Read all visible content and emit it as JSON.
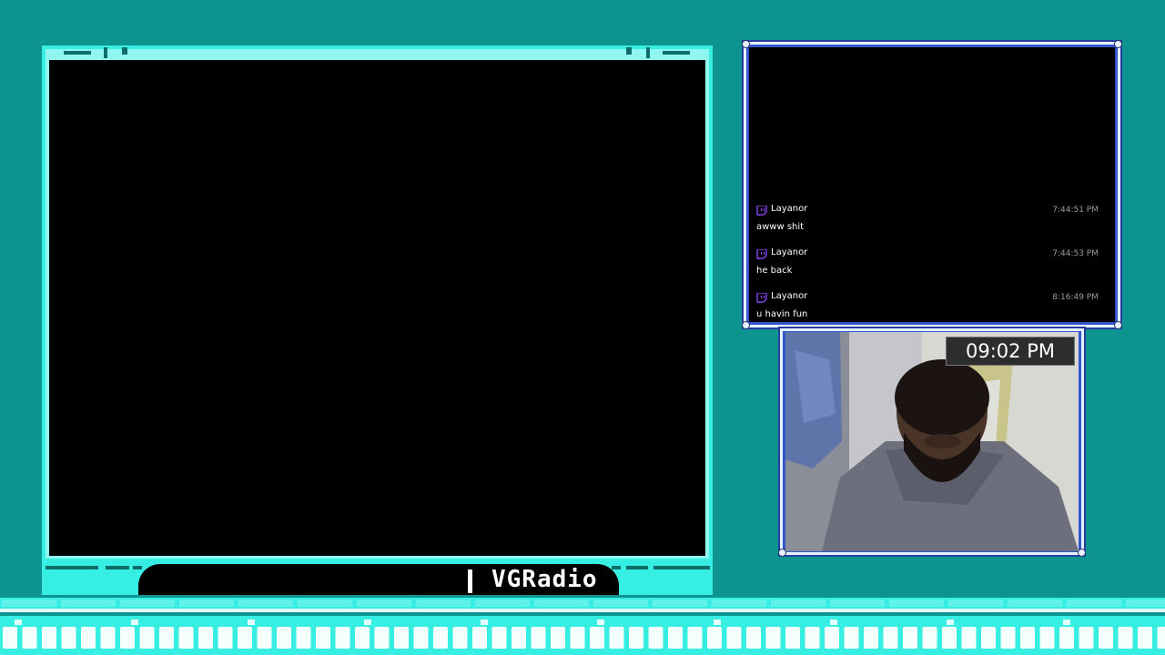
{
  "ticker": {
    "label": "VGRadio"
  },
  "chat": {
    "messages": [
      {
        "user": "Layanor",
        "time": "7:44:51 PM",
        "text": "awww shit"
      },
      {
        "user": "Layanor",
        "time": "7:44:53 PM",
        "text": "he back"
      },
      {
        "user": "Layanor",
        "time": "8:16:49 PM",
        "text": "u havin fun"
      }
    ]
  },
  "webcam": {
    "clock": "09:02 PM"
  },
  "colors": {
    "background": "#0d9490",
    "frame_cyan": "#37eee2",
    "chat_frame_blue": "#3356c8",
    "twitch_purple": "#9146ff",
    "timestamp_gray": "#9c9c9c"
  },
  "icons": {
    "platform": "twitch-icon"
  }
}
